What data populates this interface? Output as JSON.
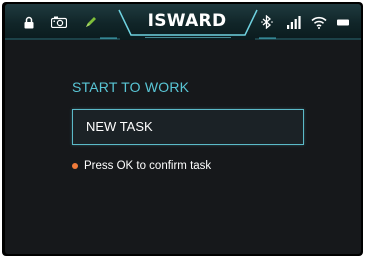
{
  "status_bar": {
    "title": "ISWARD",
    "icons": [
      "lock-icon",
      "camera-icon",
      "pen-icon",
      "bluetooth-icon",
      "signal-icon",
      "wifi-icon",
      "battery-icon"
    ]
  },
  "main": {
    "heading": "START TO WORK",
    "task_button_label": "NEW TASK",
    "hint_text": "Press OK to confirm task"
  },
  "colors": {
    "accent": "#59c6d6",
    "hint_dot": "#f07a3a",
    "pen_icon": "#7fbf3a",
    "background": "#16181b"
  }
}
